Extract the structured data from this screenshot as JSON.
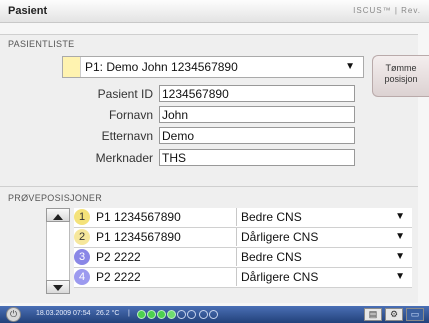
{
  "window": {
    "title": "Pasient",
    "logo": "ISCUS™ | Rev."
  },
  "patient_list": {
    "section_label": "PASIENTLISTE",
    "selected_patient": "P1: Demo John 1234567890",
    "clear_button_line1": "Tømme",
    "clear_button_line2": "posisjon",
    "fields": {
      "patient_id_label": "Pasient ID",
      "patient_id_value": "1234567890",
      "first_name_label": "Fornavn",
      "first_name_value": "John",
      "last_name_label": "Etternavn",
      "last_name_value": "Demo",
      "notes_label": "Merknader",
      "notes_value": "THS"
    }
  },
  "sample_positions": {
    "section_label": "PRØVEPOSISJONER",
    "rows": [
      {
        "number": "1",
        "patient": "P1 1234567890",
        "condition": "Bedre CNS",
        "color": "#f4e27a"
      },
      {
        "number": "2",
        "patient": "P1 1234567890",
        "condition": "Dårligere CNS",
        "color": "#f6e79c"
      },
      {
        "number": "3",
        "patient": "P2 2222",
        "condition": "Bedre CNS",
        "color": "#8a87e6"
      },
      {
        "number": "4",
        "patient": "P2 2222",
        "condition": "Dårligere CNS",
        "color": "#9c9aef"
      }
    ]
  },
  "status_bar": {
    "datetime": "18.03.2009 07:54",
    "temperature": "26.2 °C",
    "separator": "|"
  }
}
